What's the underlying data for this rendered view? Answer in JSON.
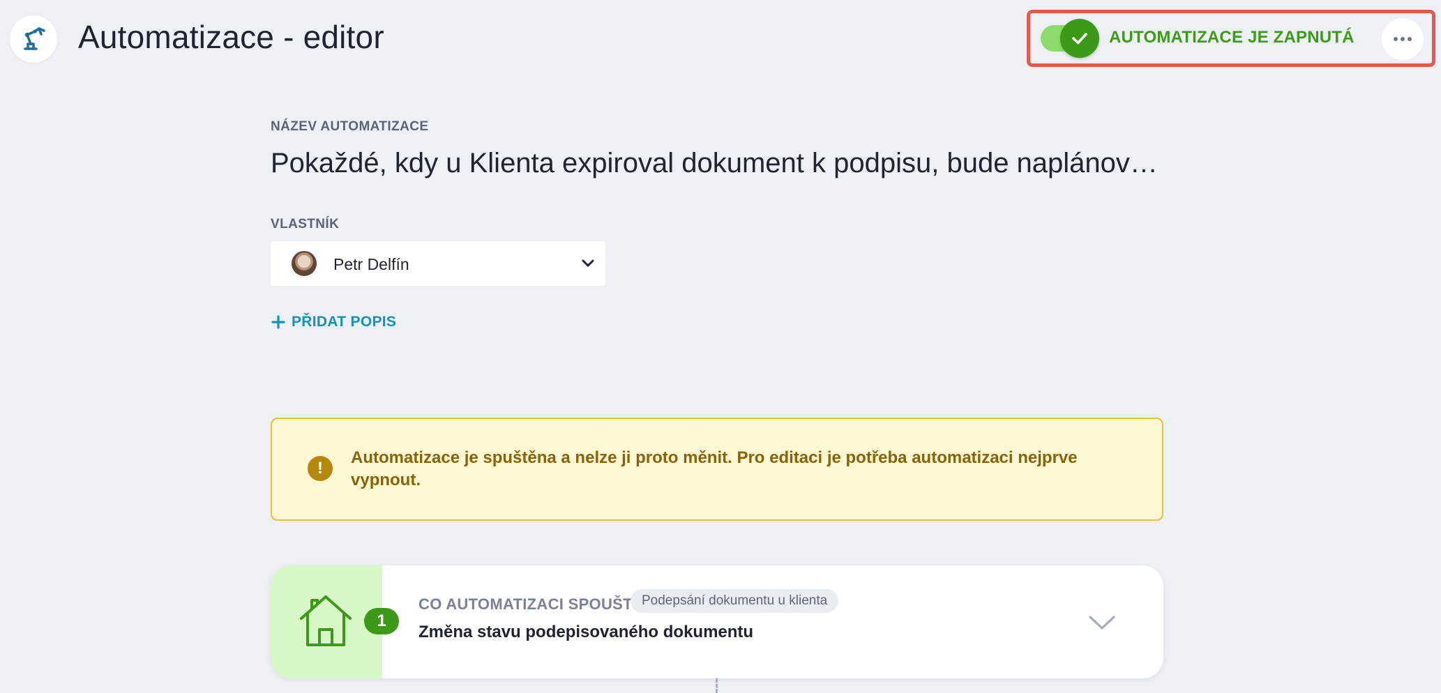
{
  "header": {
    "title": "Automatizace - editor",
    "logo_icon": "robot-arm-icon",
    "toggle": {
      "state": "on",
      "status_text": "AUTOMATIZACE JE ZAPNUTÁ"
    },
    "more_icon": "more-horizontal-icon"
  },
  "name_section": {
    "label": "NÁZEV AUTOMATIZACE",
    "value": "Pokaždé, kdy u Klienta expiroval dokument k podpisu, bude naplánov…"
  },
  "owner_section": {
    "label": "VLASTNÍK",
    "selected": "Petr Delfín"
  },
  "add_description": {
    "label": "PŘIDAT POPIS"
  },
  "alert": {
    "text": "Automatizace je spuštěna a nelze ji proto měnit. Pro editaci je potřeba automatizaci nejprve vypnout.",
    "icon": "!"
  },
  "trigger": {
    "step": "1",
    "icon": "house-icon",
    "label": "CO AUTOMATIZACI SPOUŠTÍ",
    "tag": "Podepsání dokumentu u klienta",
    "title": "Změna stavu podepisovaného dokumentu"
  },
  "colors": {
    "background": "#edf0f4",
    "accent_green": "#3c9a16",
    "link_blue": "#1493b8",
    "alert_text": "#8a6308",
    "alert_border": "#ebbf39",
    "highlight_border": "#e5594d"
  }
}
